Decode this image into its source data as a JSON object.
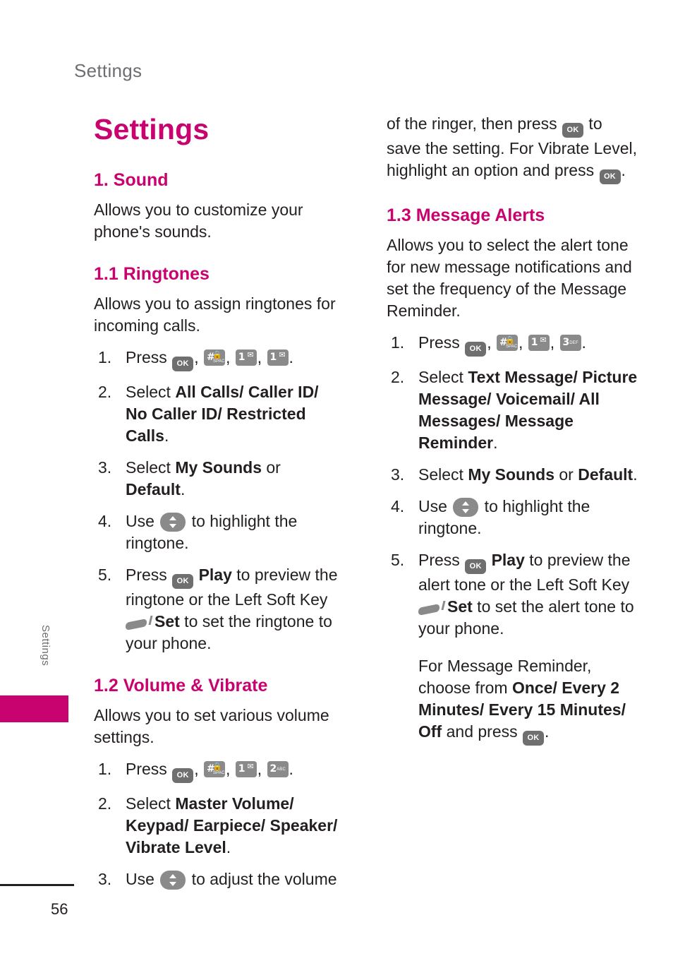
{
  "header": {
    "running_head": "Settings"
  },
  "side_tab": {
    "label": "Settings"
  },
  "footer": {
    "page_number": "56"
  },
  "title": "Settings",
  "left_column": {
    "s1": {
      "heading": "1. Sound",
      "body": "Allows you to customize your phone's sounds."
    },
    "s11": {
      "heading": "1.1 Ringtones",
      "body": "Allows you to assign ringtones for incoming calls.",
      "steps": [
        {
          "num": "1.",
          "a": "Press ",
          "b": ", ",
          "c": ", ",
          "d": ", ",
          "e": "."
        },
        {
          "num": "2.",
          "a": "Select ",
          "bold": "All Calls/ Caller ID/ No Caller ID/ Restricted Calls",
          "z": "."
        },
        {
          "num": "3.",
          "a": "Select ",
          "bold": "My Sounds",
          "mid": " or ",
          "bold2": "Default",
          "z": "."
        },
        {
          "num": "4.",
          "a": "Use ",
          "b": " to highlight the ringtone."
        },
        {
          "num": "5.",
          "a": "Press ",
          "bold": "Play",
          "b": " to preview the ringtone or the Left Soft Key ",
          "bold2": "Set",
          "c": " to set the ringtone to your phone."
        }
      ]
    },
    "s12": {
      "heading": "1.2 Volume & Vibrate",
      "body": "Allows you to set various volume settings.",
      "steps": [
        {
          "num": "1.",
          "a": "Press ",
          "b": ", ",
          "c": ", ",
          "d": ", ",
          "e": "."
        },
        {
          "num": "2.",
          "a": "Select ",
          "bold": "Master Volume/ Keypad/ Earpiece/ Speaker/ Vibrate Level",
          "z": "."
        },
        {
          "num": "3.",
          "a": "Use ",
          "b": " to adjust the volume"
        }
      ]
    }
  },
  "right_column": {
    "cont": {
      "a": "of the ringer, then press ",
      "b": " to save the setting. For Vibrate Level, highlight an option and press ",
      "c": "."
    },
    "s13": {
      "heading": "1.3 Message Alerts",
      "body": "Allows you to select the alert tone for new message notifications and set the frequency of the Message Reminder.",
      "steps": [
        {
          "num": "1.",
          "a": "Press ",
          "b": ", ",
          "c": ", ",
          "d": ", ",
          "e": "."
        },
        {
          "num": "2.",
          "a": "Select ",
          "bold": "Text Message/ Picture Message/ Voicemail/ All Messages/ Message Reminder",
          "z": "."
        },
        {
          "num": "3.",
          "a": "Select ",
          "bold": "My Sounds",
          "mid": " or ",
          "bold2": "Default",
          "z": "."
        },
        {
          "num": "4.",
          "a": "Use ",
          "b": " to highlight the ringtone."
        },
        {
          "num": "5.",
          "a": "Press ",
          "bold": "Play",
          "b": " to preview the alert tone or the Left Soft Key ",
          "bold2": "Set",
          "c": " to set the alert tone to your phone."
        }
      ],
      "reminder": {
        "a": "For Message Reminder, choose from ",
        "bold": "Once/ Every 2 Minutes/ Every 15 Minutes/ Off",
        "b": " and press ",
        "c": "."
      }
    }
  },
  "keys": {
    "ok": "OK",
    "hash_big": "#",
    "hash_sub": "SPACE",
    "one_big": "1",
    "two_big": "2",
    "two_sub": "ABC",
    "three_big": "3",
    "three_sub": "DEF"
  },
  "colors": {
    "accent": "#c8036f",
    "text": "#231f20",
    "muted": "#6d6e71",
    "key": "#8a8a8a"
  }
}
